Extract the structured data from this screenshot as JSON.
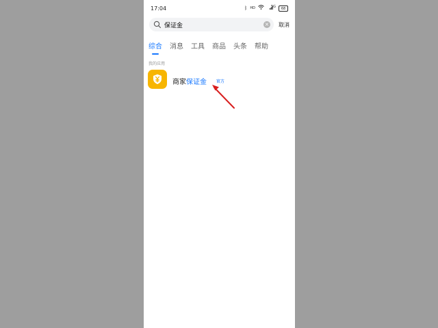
{
  "status_bar": {
    "time": "17:04",
    "bluetooth_icon": "ᛒ",
    "hd_label": "HD",
    "wifi_icon": "wifi-icon",
    "signal_label": "5G",
    "battery_level": "68"
  },
  "search": {
    "value": "保证金",
    "cancel_label": "取消"
  },
  "tabs": [
    {
      "label": "综合",
      "active": true
    },
    {
      "label": "消息",
      "active": false
    },
    {
      "label": "工具",
      "active": false
    },
    {
      "label": "商品",
      "active": false
    },
    {
      "label": "头条",
      "active": false
    },
    {
      "label": "帮助",
      "active": false
    }
  ],
  "section": {
    "title": "我的应用"
  },
  "app": {
    "name_prefix": "商家",
    "name_highlight": "保证金",
    "badge": "官方",
    "icon": "shield-yen-icon"
  },
  "colors": {
    "accent": "#1677ff",
    "app_icon_bg": "#f7b500",
    "arrow": "#d81e1e",
    "backdrop": "#9e9e9e"
  }
}
